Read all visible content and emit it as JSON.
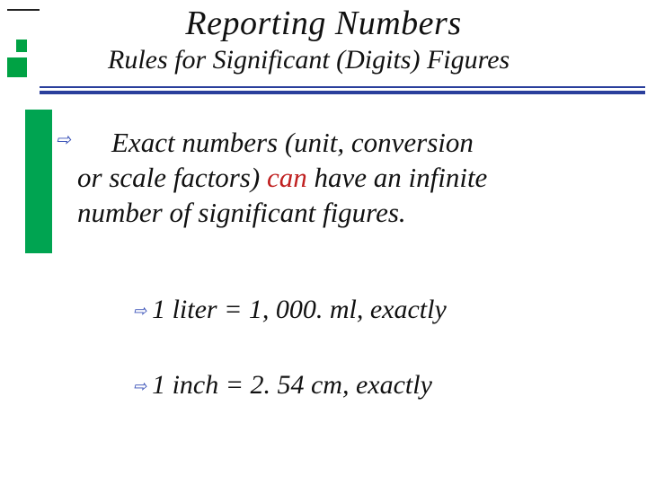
{
  "title": "Reporting Numbers",
  "subtitle": "Rules for Significant (Digits) Figures",
  "body": {
    "part1": "Exact numbers (unit, conversion",
    "part2": "or scale factors) ",
    "red": "can",
    "part3": " have an infinite",
    "part4": "number of significant figures."
  },
  "subs": [
    "1 liter  =  1, 000. ml, exactly",
    "1 inch  =  2. 54 cm, exactly"
  ],
  "colors": {
    "accent_blue": "#2a3f9c",
    "bullet_blue": "#3a52b8",
    "green": "#00a451",
    "emphasis_red": "#c02020"
  }
}
